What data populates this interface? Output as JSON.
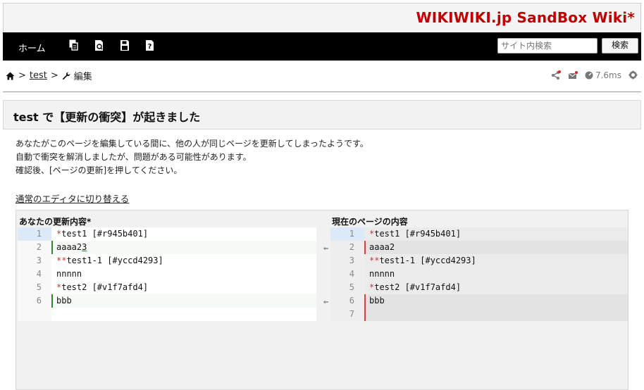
{
  "site": {
    "title": "WIKIWIKI.jp SandBox Wiki*"
  },
  "nav": {
    "home_label": "ホーム",
    "icons": [
      "copy-icon",
      "diff-icon",
      "save-icon",
      "help-icon"
    ],
    "search_placeholder": "サイト内検索",
    "search_button": "検索"
  },
  "breadcrumb": {
    "sep1": ">",
    "page": "test",
    "sep2": ">",
    "current": "編集"
  },
  "tools": {
    "timing": "7.6ms"
  },
  "title": "test で【更新の衝突】が起きました",
  "message": {
    "line1": "あなたがこのページを編集している間に、他の人が同じページを更新してしまったようです。",
    "line2": "自動で衝突を解消しましたが、問題がある可能性があります。",
    "line3": "確認後、[ページの更新]を押してください。"
  },
  "switch_editor_link": "通常のエディタに切り替える",
  "diff": {
    "left_title": "あなたの更新内容*",
    "right_title": "現在のページの内容",
    "left_lines": [
      {
        "num": "1",
        "mark": "*",
        "text": "test1 [#r945b401]"
      },
      {
        "num": "2",
        "mark": "",
        "text": "aaaa2",
        "ins": "3"
      },
      {
        "num": "3",
        "mark": "**",
        "text": "test1-1 [#yccd4293]"
      },
      {
        "num": "4",
        "mark": "",
        "text": "nnnnn"
      },
      {
        "num": "5",
        "mark": "*",
        "text": "test2 [#v1f7afd4]"
      },
      {
        "num": "6",
        "mark": "",
        "text": "bbb"
      }
    ],
    "right_lines": [
      {
        "num": "1",
        "mark": "*",
        "text": "test1 [#r945b401]"
      },
      {
        "num": "2",
        "mark": "",
        "text": "aaaa2"
      },
      {
        "num": "3",
        "mark": "**",
        "text": "test1-1 [#yccd4293]"
      },
      {
        "num": "4",
        "mark": "",
        "text": "nnnnn"
      },
      {
        "num": "5",
        "mark": "*",
        "text": "test2 [#v1f7afd4]"
      },
      {
        "num": "6",
        "mark": "",
        "text": "bbb"
      },
      {
        "num": "7",
        "mark": "",
        "text": ""
      }
    ],
    "arrow": "⇐"
  }
}
